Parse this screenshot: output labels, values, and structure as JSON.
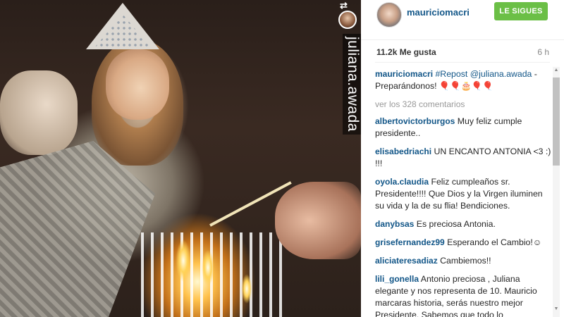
{
  "photo": {
    "watermark_username": "juliana.awada"
  },
  "post": {
    "username": "mauriciomacri",
    "follow_label": "LE SIGUES",
    "likes": "11.2k Me gusta",
    "time": "6 h",
    "caption": {
      "user": "mauriciomacri",
      "hashtag": "#Repost",
      "mention": "@juliana.awada",
      "text": " - Preparándonos! 🎈🎈🎂🎈🎈"
    },
    "view_all": "ver los 328 comentarios",
    "comments": [
      {
        "user": "albertovictorburgos",
        "text": " Muy feliz cumple presidente.."
      },
      {
        "user": "elisabedriachi",
        "text": " UN ENCANTO ANTONIA <3 :) !!!"
      },
      {
        "user": "oyola.claudia",
        "text": " Feliz cumpleaños sr. Presidente!!!! Que Dios y la Virgen iluminen su vida y la de su flia! Bendiciones."
      },
      {
        "user": "danybsas",
        "text": " Es preciosa Antonia."
      },
      {
        "user": "grisefernandez99",
        "text": " Esperando el Cambio!☺"
      },
      {
        "user": "aliciateresadiaz",
        "text": " Cambiemos!!"
      },
      {
        "user": "lili_gonella",
        "text": " Antonio preciosa , Juliana elegante y nos representa de 10. Mauricio marcaras historia, serás nuestro mejor Presidente. Sabemos que todo lo"
      }
    ]
  },
  "colors": {
    "username": "#125688",
    "follow_button": "#6bbf46"
  }
}
